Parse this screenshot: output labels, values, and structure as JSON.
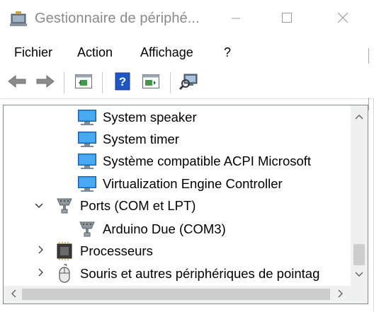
{
  "window": {
    "title": "Gestionnaire de périphé...",
    "icons": {
      "app": "device-manager-icon",
      "minimize": "minimize-icon",
      "maximize": "maximize-icon",
      "close": "close-icon"
    }
  },
  "menu": {
    "items": [
      "Fichier",
      "Action",
      "Affichage",
      "?"
    ]
  },
  "toolbar": {
    "buttons": [
      "back-arrow-icon",
      "forward-arrow-icon",
      "properties-pane-icon",
      "help-icon",
      "action-pane-icon",
      "scan-hardware-icon"
    ]
  },
  "tree": {
    "rows": [
      {
        "label": "System speaker",
        "icon": "system-device-icon",
        "expander": "none"
      },
      {
        "label": "System timer",
        "icon": "system-device-icon",
        "expander": "none"
      },
      {
        "label": "Système compatible ACPI Microsoft",
        "icon": "system-device-icon",
        "expander": "none"
      },
      {
        "label": "Virtualization Engine Controller",
        "icon": "system-device-icon",
        "expander": "none"
      },
      {
        "label": "Ports (COM et LPT)",
        "icon": "port-icon",
        "expander": "expanded"
      },
      {
        "label": "Arduino Due (COM3)",
        "icon": "port-icon",
        "expander": "none"
      },
      {
        "label": "Processeurs",
        "icon": "processor-icon",
        "expander": "collapsed"
      },
      {
        "label": "Souris et autres périphériques de pointag",
        "icon": "mouse-icon",
        "expander": "collapsed"
      }
    ]
  },
  "scrollbars": {
    "vertical_position": 0.9,
    "horizontal_position": 0.0
  },
  "colors": {
    "accent": "#1e7bd6",
    "scrollbar_track": "#f0f0f0",
    "scrollbar_thumb": "#cdcdcd"
  }
}
